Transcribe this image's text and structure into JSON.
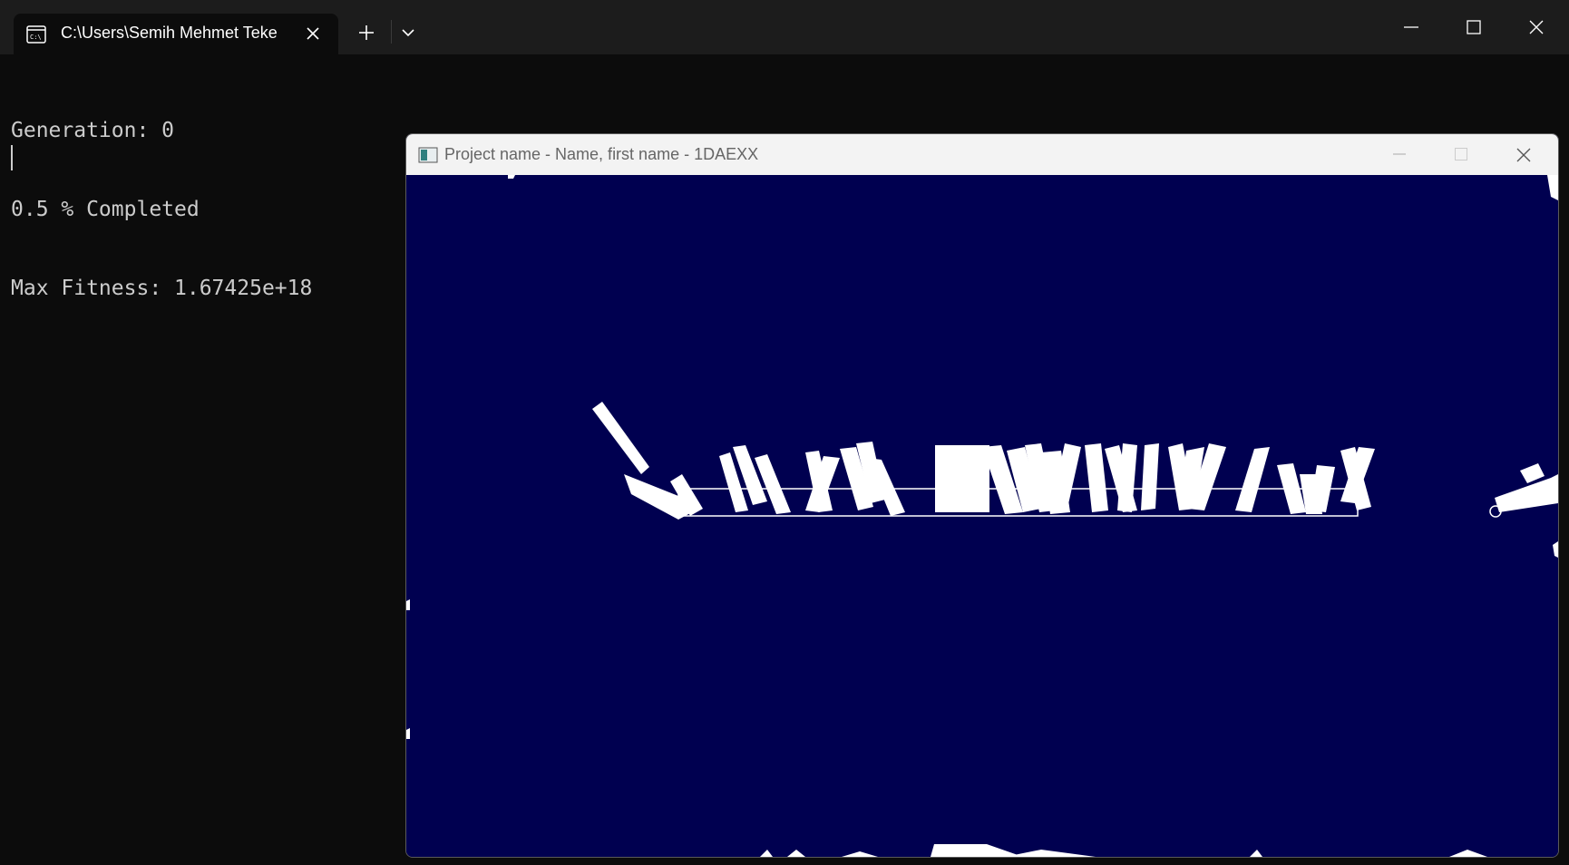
{
  "terminal": {
    "tab_title": "C:\\Users\\Semih Mehmet Teke",
    "tab_icon": "command-prompt-icon",
    "buttons": [
      "new-tab-icon",
      "dropdown-chevron-icon",
      "minimize-icon",
      "maximize-icon",
      "close-icon"
    ],
    "output_lines": [
      "Generation: 0",
      "0.5 % Completed",
      "Max Fitness: 1.67425e+18"
    ],
    "colors": {
      "background": "#0c0c0c",
      "text": "#cccccc",
      "titlebar": "#1c1c1c"
    }
  },
  "app_window": {
    "title": "Project name - Name, first name - 1DAEXX",
    "icon": "app-window-icon",
    "canvas": {
      "background": "#000050",
      "foreground": "#ffffff",
      "description": "simulation of many white rectangular agents tumbling along a track"
    }
  }
}
